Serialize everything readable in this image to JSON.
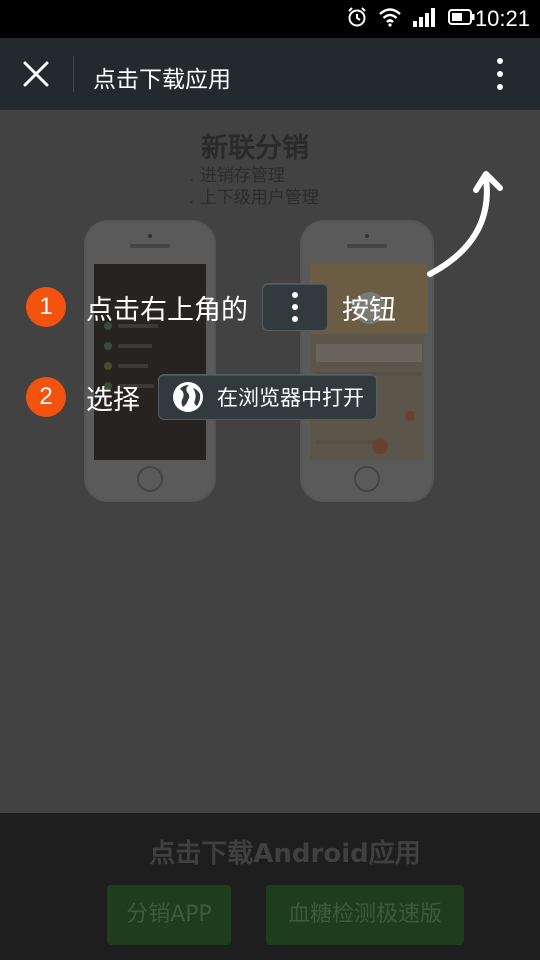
{
  "status_bar": {
    "time": "10:21"
  },
  "nav": {
    "title": "点击下载应用"
  },
  "promo": {
    "title": "新联分销",
    "features": [
      ". 进销存管理",
      ". 上下级用户管理"
    ]
  },
  "steps": [
    {
      "number": "1",
      "before": "点击右上角的",
      "after": "按钮"
    },
    {
      "number": "2",
      "before": "选择",
      "browser_label": "在浏览器中打开"
    }
  ],
  "download": {
    "title": "点击下载Android应用",
    "buttons": [
      "分销APP",
      "血糖检测极速版"
    ]
  },
  "colors": {
    "accent_orange": "#f4520f",
    "nav_bg": "#23292d",
    "download_button": "#1e3d1c"
  }
}
